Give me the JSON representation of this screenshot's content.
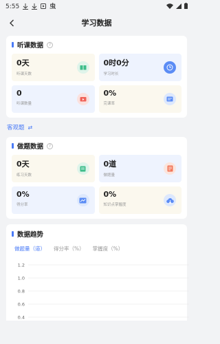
{
  "status": {
    "time": "5:55",
    "extra_icon": "虫"
  },
  "header": {
    "title": "学习数据"
  },
  "listen": {
    "title": "听课数据",
    "help": "?",
    "tiles": [
      {
        "value": "0天",
        "label": "听课天数",
        "icon": "book-icon"
      },
      {
        "value": "0时0分",
        "label": "学习时长",
        "icon": "clock-icon"
      },
      {
        "value": "0",
        "label": "听课数量",
        "icon": "video-icon"
      },
      {
        "value": "0%",
        "label": "完课率",
        "icon": "card-icon"
      }
    ]
  },
  "switch": {
    "label": "客观题",
    "icon": "⇄"
  },
  "exercise": {
    "title": "做题数据",
    "help": "?",
    "tiles": [
      {
        "value": "0天",
        "label": "练习天数",
        "icon": "calendar-icon"
      },
      {
        "value": "0道",
        "label": "做题量",
        "icon": "document-icon"
      },
      {
        "value": "0%",
        "label": "得分率",
        "icon": "score-icon"
      },
      {
        "value": "0%",
        "label": "知识点掌握度",
        "icon": "cloud-download-icon"
      }
    ]
  },
  "trend": {
    "title": "数据趋势",
    "tabs": [
      "做题量（道）",
      "得分率（%）",
      "掌握度（%）"
    ],
    "active_tab": 0
  },
  "chart_data": {
    "type": "line",
    "title": "",
    "xlabel": "",
    "ylabel": "",
    "ylim": [
      0.4,
      1.2
    ],
    "yticks": [
      "1.2",
      "1.0",
      "0.8",
      "0.6",
      "0.4"
    ],
    "series": []
  }
}
